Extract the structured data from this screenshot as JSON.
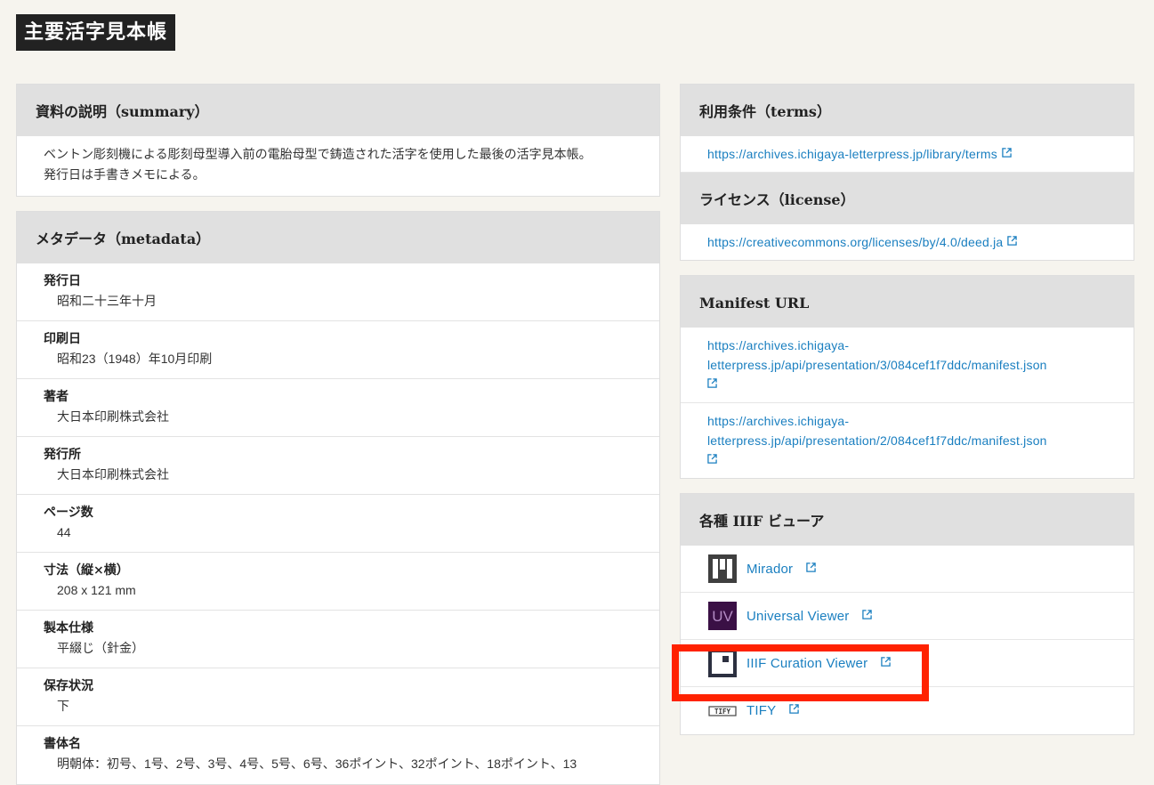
{
  "title": "主要活字見本帳",
  "summary": {
    "header": "資料の説明（summary）",
    "lines": [
      "ベントン彫刻機による彫刻母型導入前の電胎母型で鋳造された活字を使用した最後の活字見本帳。",
      "発行日は手書きメモによる。"
    ]
  },
  "metadata": {
    "header": "メタデータ（metadata）",
    "items": [
      {
        "label": "発行日",
        "value": "昭和二十三年十月"
      },
      {
        "label": "印刷日",
        "value": "昭和23（1948）年10月印刷"
      },
      {
        "label": "著者",
        "value": "大日本印刷株式会社"
      },
      {
        "label": "発行所",
        "value": "大日本印刷株式会社"
      },
      {
        "label": "ページ数",
        "value": "44"
      },
      {
        "label": "寸法（縦×横）",
        "value": "208 x 121 mm"
      },
      {
        "label": "製本仕様",
        "value": "平綴じ（針金）"
      },
      {
        "label": "保存状況",
        "value": "下"
      },
      {
        "label": "書体名",
        "value": "明朝体：初号、1号、2号、3号、4号、5号、6号、36ポイント、32ポイント、18ポイント、13"
      }
    ]
  },
  "terms": {
    "header": "利用条件（terms）",
    "link": "https://archives.ichigaya-letterpress.jp/library/terms"
  },
  "license": {
    "header": "ライセンス（license）",
    "link": "https://creativecommons.org/licenses/by/4.0/deed.ja"
  },
  "manifest": {
    "header": "Manifest URL",
    "links": [
      {
        "line1": "https://archives.ichigaya-",
        "line2": "letterpress.jp/api/presentation/3/084cef1f7ddc/manifest.json"
      },
      {
        "line1": "https://archives.ichigaya-",
        "line2": "letterpress.jp/api/presentation/2/084cef1f7ddc/manifest.json"
      }
    ]
  },
  "viewers": {
    "header": "各種 IIIF ビューア",
    "items": [
      {
        "label": "Mirador",
        "icon": "mirador-logo-icon"
      },
      {
        "label": "Universal Viewer",
        "icon": "universal-viewer-logo-icon",
        "logo_text": "UV"
      },
      {
        "label": "IIIF Curation Viewer",
        "icon": "curation-viewer-logo-icon"
      },
      {
        "label": "TIFY",
        "icon": "tify-logo-icon",
        "logo_text": "TIFY"
      }
    ]
  },
  "colors": {
    "link": "#1a7fc0",
    "highlight": "#ff2200",
    "title_bg": "#222222",
    "header_bg": "#e0e0e0",
    "page_bg": "#f6f4ee"
  }
}
